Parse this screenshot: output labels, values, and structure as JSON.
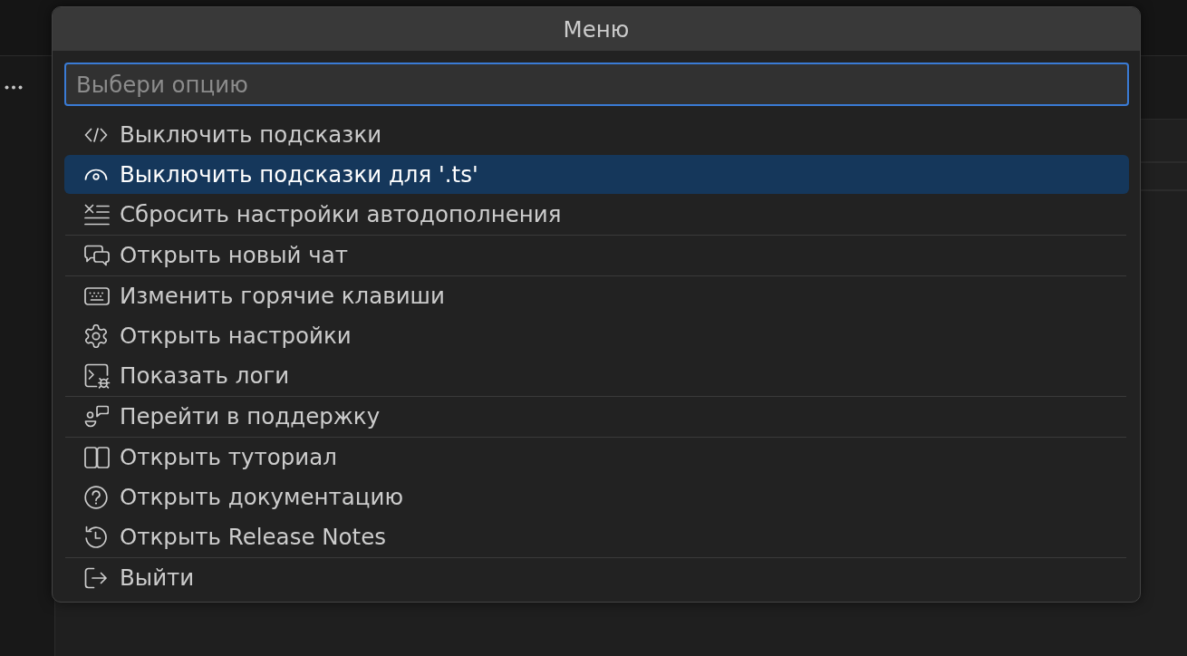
{
  "dialog": {
    "title": "Меню",
    "input": {
      "placeholder": "Выбери опцию",
      "focused": true
    },
    "groups": [
      {
        "items": [
          {
            "label": "Выключить подсказки",
            "selected": false
          },
          {
            "label": "Выключить подсказки для '.ts'",
            "selected": true
          },
          {
            "label": "Сбросить настройки автодополнения",
            "selected": false
          }
        ]
      },
      {
        "items": [
          {
            "label": "Открыть новый чат",
            "selected": false
          }
        ]
      },
      {
        "items": [
          {
            "label": "Изменить горячие клавиши",
            "selected": false
          },
          {
            "label": "Открыть настройки",
            "selected": false
          },
          {
            "label": "Показать логи",
            "selected": false
          }
        ]
      },
      {
        "items": [
          {
            "label": "Перейти в поддержку",
            "selected": false
          }
        ]
      },
      {
        "items": [
          {
            "label": "Открыть туториал",
            "selected": false
          },
          {
            "label": "Открыть документацию",
            "selected": false
          },
          {
            "label": "Открыть Release Notes",
            "selected": false
          }
        ]
      },
      {
        "items": [
          {
            "label": "Выйти",
            "selected": false
          }
        ]
      }
    ]
  }
}
